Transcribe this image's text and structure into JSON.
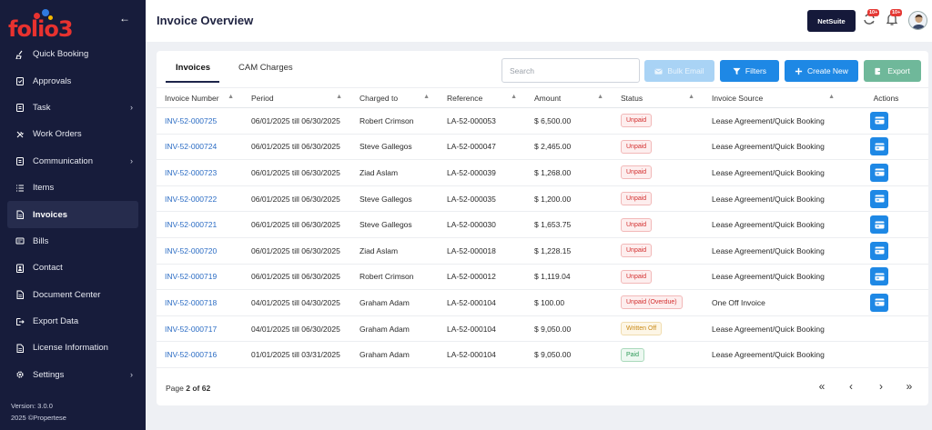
{
  "brand": {
    "logo_text": "folio3",
    "dot_colors": [
      "#e8322f",
      "#2f7ae0",
      "#f5b800"
    ]
  },
  "sidebar": {
    "items": [
      {
        "label": "Quick Booking",
        "icon": "broom-icon",
        "chevron": false,
        "active": false
      },
      {
        "label": "Approvals",
        "icon": "clipboard-check-icon",
        "chevron": false,
        "active": false
      },
      {
        "label": "Task",
        "icon": "clipboard-icon",
        "chevron": true,
        "active": false
      },
      {
        "label": "Work Orders",
        "icon": "tools-icon",
        "chevron": false,
        "active": false
      },
      {
        "label": "Communication",
        "icon": "clipboard-icon",
        "chevron": true,
        "active": false
      },
      {
        "label": "Items",
        "icon": "list-icon",
        "chevron": false,
        "active": false
      },
      {
        "label": "Invoices",
        "icon": "document-icon",
        "chevron": false,
        "active": true
      },
      {
        "label": "Bills",
        "icon": "bill-icon",
        "chevron": false,
        "active": false
      },
      {
        "label": "Contact",
        "icon": "contact-book-icon",
        "chevron": false,
        "active": false
      },
      {
        "label": "Document Center",
        "icon": "document-icon",
        "chevron": false,
        "active": false
      },
      {
        "label": "Export Data",
        "icon": "export-icon",
        "chevron": false,
        "active": false
      },
      {
        "label": "License Information",
        "icon": "document-icon",
        "chevron": false,
        "active": false
      },
      {
        "label": "Settings",
        "icon": "gear-icon",
        "chevron": true,
        "active": false
      }
    ],
    "version": "Version: 3.0.0",
    "copyright": "2025 ©Propertese"
  },
  "header": {
    "title": "Invoice Overview",
    "netsuite_label": "NetSuite",
    "sync_badge": "10+",
    "notif_badge": "10+"
  },
  "tabs": [
    {
      "label": "Invoices",
      "active": true
    },
    {
      "label": "CAM Charges",
      "active": false
    }
  ],
  "toolbar": {
    "search_placeholder": "Search",
    "bulk_email": "Bulk Email",
    "filters": "Filters",
    "create_new": "Create New",
    "export": "Export"
  },
  "table": {
    "columns": [
      "Invoice Number",
      "Period",
      "Charged to",
      "Reference",
      "Amount",
      "Status",
      "Invoice Source",
      "Actions"
    ],
    "rows": [
      {
        "invoice": "INV-52-000725",
        "period": "06/01/2025 till 06/30/2025",
        "charged_to": "Robert Crimson",
        "reference": "LA-52-000053",
        "amount": "$ 6,500.00",
        "status": "Unpaid",
        "status_kind": "unpaid",
        "source": "Lease Agreement/Quick Booking",
        "has_action": true
      },
      {
        "invoice": "INV-52-000724",
        "period": "06/01/2025 till 06/30/2025",
        "charged_to": "Steve Gallegos",
        "reference": "LA-52-000047",
        "amount": "$ 2,465.00",
        "status": "Unpaid",
        "status_kind": "unpaid",
        "source": "Lease Agreement/Quick Booking",
        "has_action": true
      },
      {
        "invoice": "INV-52-000723",
        "period": "06/01/2025 till 06/30/2025",
        "charged_to": "Ziad Aslam",
        "reference": "LA-52-000039",
        "amount": "$ 1,268.00",
        "status": "Unpaid",
        "status_kind": "unpaid",
        "source": "Lease Agreement/Quick Booking",
        "has_action": true
      },
      {
        "invoice": "INV-52-000722",
        "period": "06/01/2025 till 06/30/2025",
        "charged_to": "Steve Gallegos",
        "reference": "LA-52-000035",
        "amount": "$ 1,200.00",
        "status": "Unpaid",
        "status_kind": "unpaid",
        "source": "Lease Agreement/Quick Booking",
        "has_action": true
      },
      {
        "invoice": "INV-52-000721",
        "period": "06/01/2025 till 06/30/2025",
        "charged_to": "Steve Gallegos",
        "reference": "LA-52-000030",
        "amount": "$ 1,653.75",
        "status": "Unpaid",
        "status_kind": "unpaid",
        "source": "Lease Agreement/Quick Booking",
        "has_action": true
      },
      {
        "invoice": "INV-52-000720",
        "period": "06/01/2025 till 06/30/2025",
        "charged_to": "Ziad Aslam",
        "reference": "LA-52-000018",
        "amount": "$ 1,228.15",
        "status": "Unpaid",
        "status_kind": "unpaid",
        "source": "Lease Agreement/Quick Booking",
        "has_action": true
      },
      {
        "invoice": "INV-52-000719",
        "period": "06/01/2025 till 06/30/2025",
        "charged_to": "Robert Crimson",
        "reference": "LA-52-000012",
        "amount": "$ 1,119.04",
        "status": "Unpaid",
        "status_kind": "unpaid",
        "source": "Lease Agreement/Quick Booking",
        "has_action": true
      },
      {
        "invoice": "INV-52-000718",
        "period": "04/01/2025 till 04/30/2025",
        "charged_to": "Graham Adam",
        "reference": "LA-52-000104",
        "amount": "$ 100.00",
        "status": "Unpaid (Overdue)",
        "status_kind": "unpaid",
        "source": "One Off Invoice",
        "has_action": true
      },
      {
        "invoice": "INV-52-000717",
        "period": "04/01/2025 till 06/30/2025",
        "charged_to": "Graham Adam",
        "reference": "LA-52-000104",
        "amount": "$ 9,050.00",
        "status": "Written Off",
        "status_kind": "written",
        "source": "Lease Agreement/Quick Booking",
        "has_action": false
      },
      {
        "invoice": "INV-52-000716",
        "period": "01/01/2025 till 03/31/2025",
        "charged_to": "Graham Adam",
        "reference": "LA-52-000104",
        "amount": "$ 9,050.00",
        "status": "Paid",
        "status_kind": "paid",
        "source": "Lease Agreement/Quick Booking",
        "has_action": false
      }
    ]
  },
  "pagination": {
    "page_label": "Page",
    "current": "2",
    "of_label": "of",
    "total": "62",
    "first_icon": "«",
    "prev_icon": "‹",
    "next_icon": "›",
    "last_icon": "»"
  }
}
